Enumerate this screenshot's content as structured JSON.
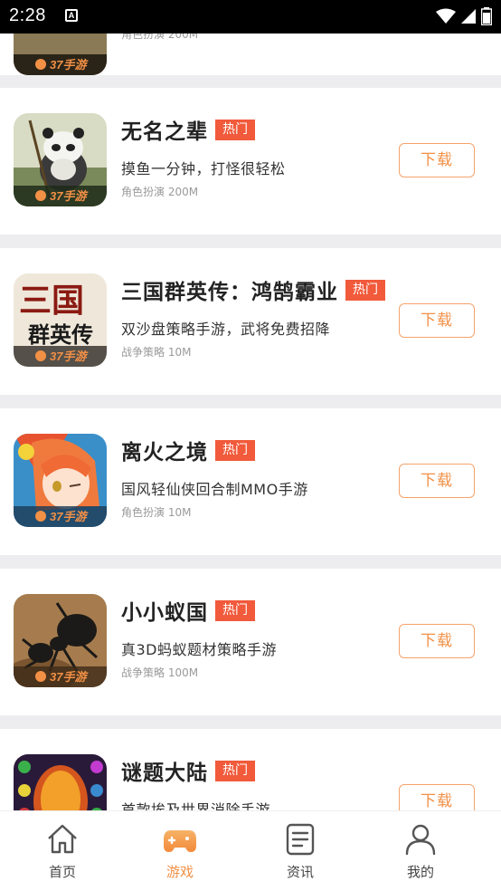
{
  "status_bar": {
    "time": "2:28",
    "notification_letter": "A"
  },
  "games": [
    {
      "title": "无名之辈",
      "tag": "热门",
      "desc": "摸鱼一分钟，打怪很轻松",
      "meta": "角色扮演 200M",
      "button": "下载",
      "icon": "panda-warrior-icon",
      "brand": "37手游"
    },
    {
      "title": "三国群英传：鸿鹄霸业",
      "tag": "热门",
      "desc": "双沙盘策略手游，武将免费招降",
      "meta": "战争策略 10M",
      "button": "下载",
      "icon": "three-kingdoms-icon",
      "brand": "37手游"
    },
    {
      "title": "离火之境",
      "tag": "热门",
      "desc": "国风轻仙侠回合制MMO手游",
      "meta": "角色扮演 10M",
      "button": "下载",
      "icon": "anime-girl-icon",
      "brand": "37手游"
    },
    {
      "title": "小小蚁国",
      "tag": "热门",
      "desc": "真3D蚂蚁题材策略手游",
      "meta": "战争策略 100M",
      "button": "下载",
      "icon": "ant-icon",
      "brand": "37手游"
    },
    {
      "title": "谜题大陆",
      "tag": "热门",
      "desc": "首款埃及世界消除手游",
      "meta": "",
      "button": "下载",
      "icon": "gem-puzzle-icon",
      "brand": ""
    }
  ],
  "tabs": [
    {
      "label": "首页",
      "icon": "home-icon",
      "active": false
    },
    {
      "label": "游戏",
      "icon": "gamepad-icon",
      "active": true
    },
    {
      "label": "资讯",
      "icon": "news-icon",
      "active": false
    },
    {
      "label": "我的",
      "icon": "user-icon",
      "active": false
    }
  ],
  "colors": {
    "accent": "#f29046",
    "hot_tag": "#f15a3b",
    "divider": "#ededf0"
  }
}
